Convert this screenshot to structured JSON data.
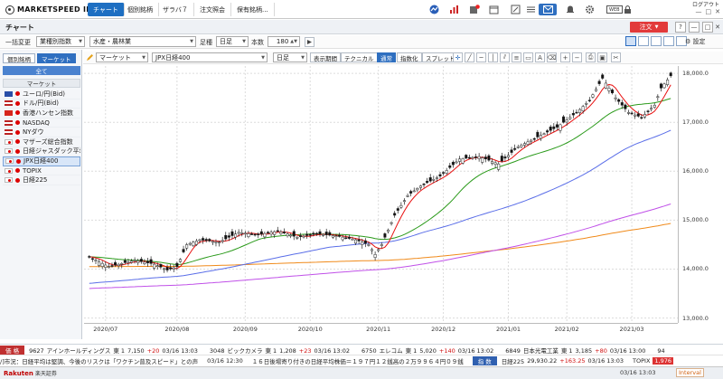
{
  "app": {
    "logo": "MARKETSPEED II",
    "tabs": [
      "チャート",
      "個別銘柄",
      "ザラバ７",
      "注文照会",
      "保有銘柄..."
    ],
    "icon_badges": {
      "mail": "",
      "notice": "N",
      "web": "WEB"
    },
    "logout": "ログアウト"
  },
  "titlebar": {
    "title": "チャート",
    "order_button": "注文",
    "help": "?"
  },
  "toolbar1": {
    "mode_label": "一括変更",
    "mode_value": "業種別指数",
    "sector_value": "水産・農林業",
    "period_label": "足種",
    "period_value": "日足",
    "count_label": "本数",
    "count_value": "180",
    "settings_label": "設定"
  },
  "sidebar": {
    "tabs": [
      "個別銘柄",
      "マーケット"
    ],
    "all_label": "全て",
    "header": "マーケット",
    "items": [
      {
        "label": "ユーロ/円(Bid)",
        "flag": "eu"
      },
      {
        "label": "ドル/円(Bid)",
        "flag": "us"
      },
      {
        "label": "香港ハンセン指数",
        "flag": "cn"
      },
      {
        "label": "NASDAQ",
        "flag": "us"
      },
      {
        "label": "NYダウ",
        "flag": "us"
      },
      {
        "label": "マザーズ総合指数",
        "flag": "jp"
      },
      {
        "label": "日経ジャスダック平均",
        "flag": "jp"
      },
      {
        "label": "JPX日経400",
        "flag": "jp",
        "selected": true
      },
      {
        "label": "TOPIX",
        "flag": "jp"
      },
      {
        "label": "日経225",
        "flag": "jp"
      }
    ]
  },
  "chart_toolbar": {
    "category": "マーケット",
    "symbol": "JPX日経400",
    "period": "日足",
    "buttons": [
      "表示期間",
      "テクニカル",
      "通常",
      "指数化",
      "スプレッド"
    ],
    "active": "通常"
  },
  "chart_data": {
    "type": "candlestick",
    "title": "",
    "symbol": "JPX日経400",
    "ylim": [
      12900,
      18150
    ],
    "y_ticks": [
      "18,000.0",
      "17,000.0",
      "16,000.0",
      "15,000.0",
      "14,000.0",
      "13,000.0"
    ],
    "y_tick_values": [
      18000,
      17000,
      16000,
      15000,
      14000,
      13000
    ],
    "x_ticks": [
      "2020/07",
      "2020/08",
      "2020/09",
      "2020/10",
      "2020/11",
      "2020/12",
      "2021/01",
      "2021/02",
      "2021/03"
    ],
    "x_tick_index": [
      5,
      27,
      48,
      68,
      89,
      109,
      129,
      147,
      167
    ],
    "n_bars": 180,
    "close_anchors": [
      [
        0,
        14250
      ],
      [
        6,
        14050
      ],
      [
        14,
        14180
      ],
      [
        20,
        14100
      ],
      [
        24,
        13980
      ],
      [
        27,
        14050
      ],
      [
        30,
        14500
      ],
      [
        34,
        14600
      ],
      [
        40,
        14550
      ],
      [
        46,
        14750
      ],
      [
        52,
        14700
      ],
      [
        58,
        14780
      ],
      [
        64,
        14650
      ],
      [
        70,
        14720
      ],
      [
        76,
        14680
      ],
      [
        82,
        14600
      ],
      [
        86,
        14500
      ],
      [
        88,
        14300
      ],
      [
        90,
        14500
      ],
      [
        94,
        15100
      ],
      [
        98,
        15500
      ],
      [
        102,
        15700
      ],
      [
        108,
        15900
      ],
      [
        114,
        16250
      ],
      [
        120,
        16300
      ],
      [
        126,
        16150
      ],
      [
        132,
        16500
      ],
      [
        138,
        16700
      ],
      [
        144,
        16900
      ],
      [
        150,
        17200
      ],
      [
        154,
        17450
      ],
      [
        158,
        17900
      ],
      [
        162,
        17500
      ],
      [
        166,
        17200
      ],
      [
        170,
        17100
      ],
      [
        174,
        17350
      ],
      [
        176,
        17700
      ],
      [
        179,
        17950
      ]
    ],
    "series": [
      {
        "name": "MA5",
        "color": "#e81010",
        "period": 5
      },
      {
        "name": "MA25",
        "color": "#2a9a1a",
        "period": 25
      },
      {
        "name": "MA75",
        "color": "#5a6ee8",
        "period": 75
      },
      {
        "name": "MA200",
        "color": "#c050e8",
        "period": 200
      },
      {
        "name": "MA300",
        "color": "#f08a1a",
        "period": 300
      }
    ],
    "grid": true,
    "up_color": "#ffffff",
    "down_color": "#111111"
  },
  "ticker1": {
    "tag": "価 格",
    "items": [
      {
        "code": "9627",
        "name": "アインホールディングス",
        "market": "東 1",
        "price": "7,150",
        "change": "+20",
        "time": "03/16 13:03"
      },
      {
        "code": "3048",
        "name": "ビックカメラ",
        "market": "東 1",
        "price": "1,208",
        "change": "+23",
        "time": "03/16 13:02"
      },
      {
        "code": "6750",
        "name": "エレコム",
        "market": "東 1",
        "price": "5,020",
        "change": "+140",
        "time": "03/16 13:02"
      },
      {
        "code": "6849",
        "name": "日本光電工業",
        "market": "東 1",
        "price": "3,185",
        "change": "+80",
        "time": "03/16 13:00"
      },
      {
        "code": "",
        "name": "94",
        "market": "",
        "price": "",
        "change": "",
        "time": ""
      }
    ]
  },
  "ticker2": {
    "news": "/]市況：日経平均は堅調、今後のリスクは「ワクチン普及スピード」との声",
    "news_time": "03/16 12:30",
    "news2": "１６日後場寄り付きの日経平均株価＝１９７円１２銭高の２万９９６４円０９銭",
    "tag": "指 数",
    "index1_name": "日経225",
    "index1_value": "29,930.22",
    "index1_change": "+163.25",
    "index1_time": "03/16 13:03",
    "index2_name": "TOPIX",
    "index2_value": "1,976"
  },
  "status": {
    "brand": "Rakuten",
    "brand_sub": "楽天証券",
    "time": "03/16 13:03",
    "interval": "Interval"
  }
}
